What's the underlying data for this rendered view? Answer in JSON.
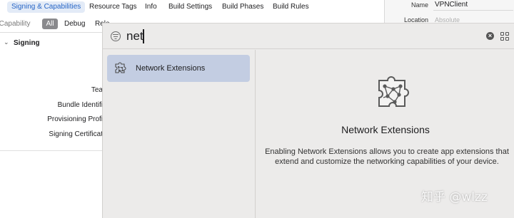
{
  "tabs": [
    {
      "label": "Signing & Capabilities",
      "active": true
    },
    {
      "label": "Resource Tags",
      "active": false
    },
    {
      "label": "Info",
      "active": false
    },
    {
      "label": "Build Settings",
      "active": false
    },
    {
      "label": "Build Phases",
      "active": false
    },
    {
      "label": "Build Rules",
      "active": false
    }
  ],
  "filter_bar": {
    "capability_label": "Capability",
    "all_label": "All",
    "debug_label": "Debug",
    "release_label": "Rele"
  },
  "signing": {
    "section_title": "Signing",
    "fields": [
      "Tea",
      "Bundle Identifi",
      "Provisioning Profi",
      "Signing Certificat"
    ]
  },
  "inspector": {
    "name_label": "Name",
    "name_value": "VPNClient",
    "location_label": "Location",
    "location_value": "Absolute"
  },
  "library": {
    "search_value": "net",
    "list_items": [
      {
        "label": "Network Extensions",
        "icon": "puzzle-piece-network-icon",
        "selected": true
      }
    ],
    "detail": {
      "title": "Network Extensions",
      "description": "Enabling Network Extensions allows you to create app extensions that extend and customize the networking capabilities of your device."
    }
  },
  "watermark": "知乎 @wlzz",
  "colors": {
    "accent": "#2665c6",
    "selection": "#c3cde2",
    "library_bg": "#ecebea"
  }
}
